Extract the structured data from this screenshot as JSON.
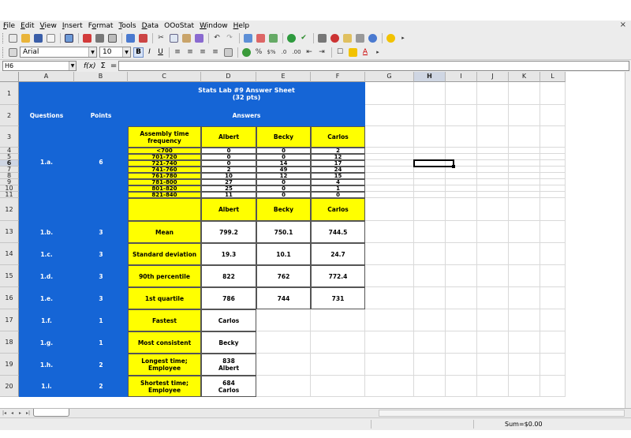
{
  "menu": {
    "items": [
      {
        "label": "File",
        "u": "F",
        "rest": "ile"
      },
      {
        "label": "Edit",
        "u": "E",
        "rest": "dit"
      },
      {
        "label": "View",
        "u": "V",
        "rest": "iew"
      },
      {
        "label": "Insert",
        "u": "I",
        "rest": "nsert"
      },
      {
        "label": "Format",
        "u": "o",
        "pre": "F",
        "rest": "rmat"
      },
      {
        "label": "Tools",
        "u": "T",
        "rest": "ools"
      },
      {
        "label": "Data",
        "u": "D",
        "rest": "ata"
      },
      {
        "label": "OOoStat",
        "u": "",
        "rest": "OOoStat"
      },
      {
        "label": "Window",
        "u": "W",
        "rest": "indow"
      },
      {
        "label": "Help",
        "u": "H",
        "rest": "elp"
      }
    ],
    "close_glyph": "×"
  },
  "format_toolbar": {
    "font_name": "Arial",
    "font_size": "10",
    "bold": "B",
    "italic": "I",
    "underline": "U"
  },
  "formula_bar": {
    "cell_ref": "H6",
    "fx": "f(x)",
    "sigma": "Σ",
    "equals": "=",
    "value": ""
  },
  "columns": [
    "A",
    "B",
    "C",
    "D",
    "E",
    "F",
    "G",
    "H",
    "I",
    "J",
    "K",
    "L"
  ],
  "selected_column": "H",
  "rows": [
    "1",
    "2",
    "3",
    "4",
    "5",
    "6",
    "7",
    "8",
    "9",
    "10",
    "11",
    "12",
    "13",
    "14",
    "15",
    "16",
    "17",
    "18",
    "19",
    "20"
  ],
  "selected_row": "6",
  "sheet": {
    "title_line1": "Stats Lab #9 Answer Sheet",
    "title_line2": "(32 pts)",
    "questions_header": "Questions",
    "points_header": "Points",
    "answers_header": "Answers",
    "freq_header": "Assembly time frequency",
    "people": [
      "Albert",
      "Becky",
      "Carlos"
    ],
    "q1a": {
      "question": "1.a.",
      "points": "6"
    },
    "freq_table": [
      {
        "range": "<700",
        "albert": "0",
        "becky": "0",
        "carlos": "2"
      },
      {
        "range": "701-720",
        "albert": "0",
        "becky": "0",
        "carlos": "12"
      },
      {
        "range": "721-740",
        "albert": "0",
        "becky": "14",
        "carlos": "17"
      },
      {
        "range": "741-760",
        "albert": "2",
        "becky": "49",
        "carlos": "24"
      },
      {
        "range": "761-780",
        "albert": "10",
        "becky": "12",
        "carlos": "15"
      },
      {
        "range": "781-800",
        "albert": "27",
        "becky": "0",
        "carlos": "4"
      },
      {
        "range": "801-820",
        "albert": "25",
        "becky": "0",
        "carlos": "1"
      },
      {
        "range": "821-840",
        "albert": "11",
        "becky": "0",
        "carlos": "0"
      }
    ],
    "stats": [
      {
        "question": "1.b.",
        "points": "3",
        "label": "Mean",
        "albert": "799.2",
        "becky": "750.1",
        "carlos": "744.5"
      },
      {
        "question": "1.c.",
        "points": "3",
        "label": "Standard deviation",
        "albert": "19.3",
        "becky": "10.1",
        "carlos": "24.7"
      },
      {
        "question": "1.d.",
        "points": "3",
        "label": "90th percentile",
        "albert": "822",
        "becky": "762",
        "carlos": "772.4"
      },
      {
        "question": "1.e.",
        "points": "3",
        "label": "1st quartile",
        "albert": "786",
        "becky": "744",
        "carlos": "731"
      }
    ],
    "singles": [
      {
        "question": "1.f.",
        "points": "1",
        "label": "Fastest",
        "answer_line1": "Carlos",
        "answer_line2": ""
      },
      {
        "question": "1.g.",
        "points": "1",
        "label": "Most consistent",
        "answer_line1": "Becky",
        "answer_line2": ""
      },
      {
        "question": "1.h.",
        "points": "2",
        "label": "Longest time; Employee",
        "answer_line1": "838",
        "answer_line2": "Albert"
      },
      {
        "question": "1.i.",
        "points": "2",
        "label": "Shortest time; Employee",
        "answer_line1": "684",
        "answer_line2": "Carlos"
      }
    ]
  },
  "status": {
    "sum": "Sum=$0.00"
  },
  "colors": {
    "blue": "#1565d6",
    "yellow": "#ffff00"
  }
}
